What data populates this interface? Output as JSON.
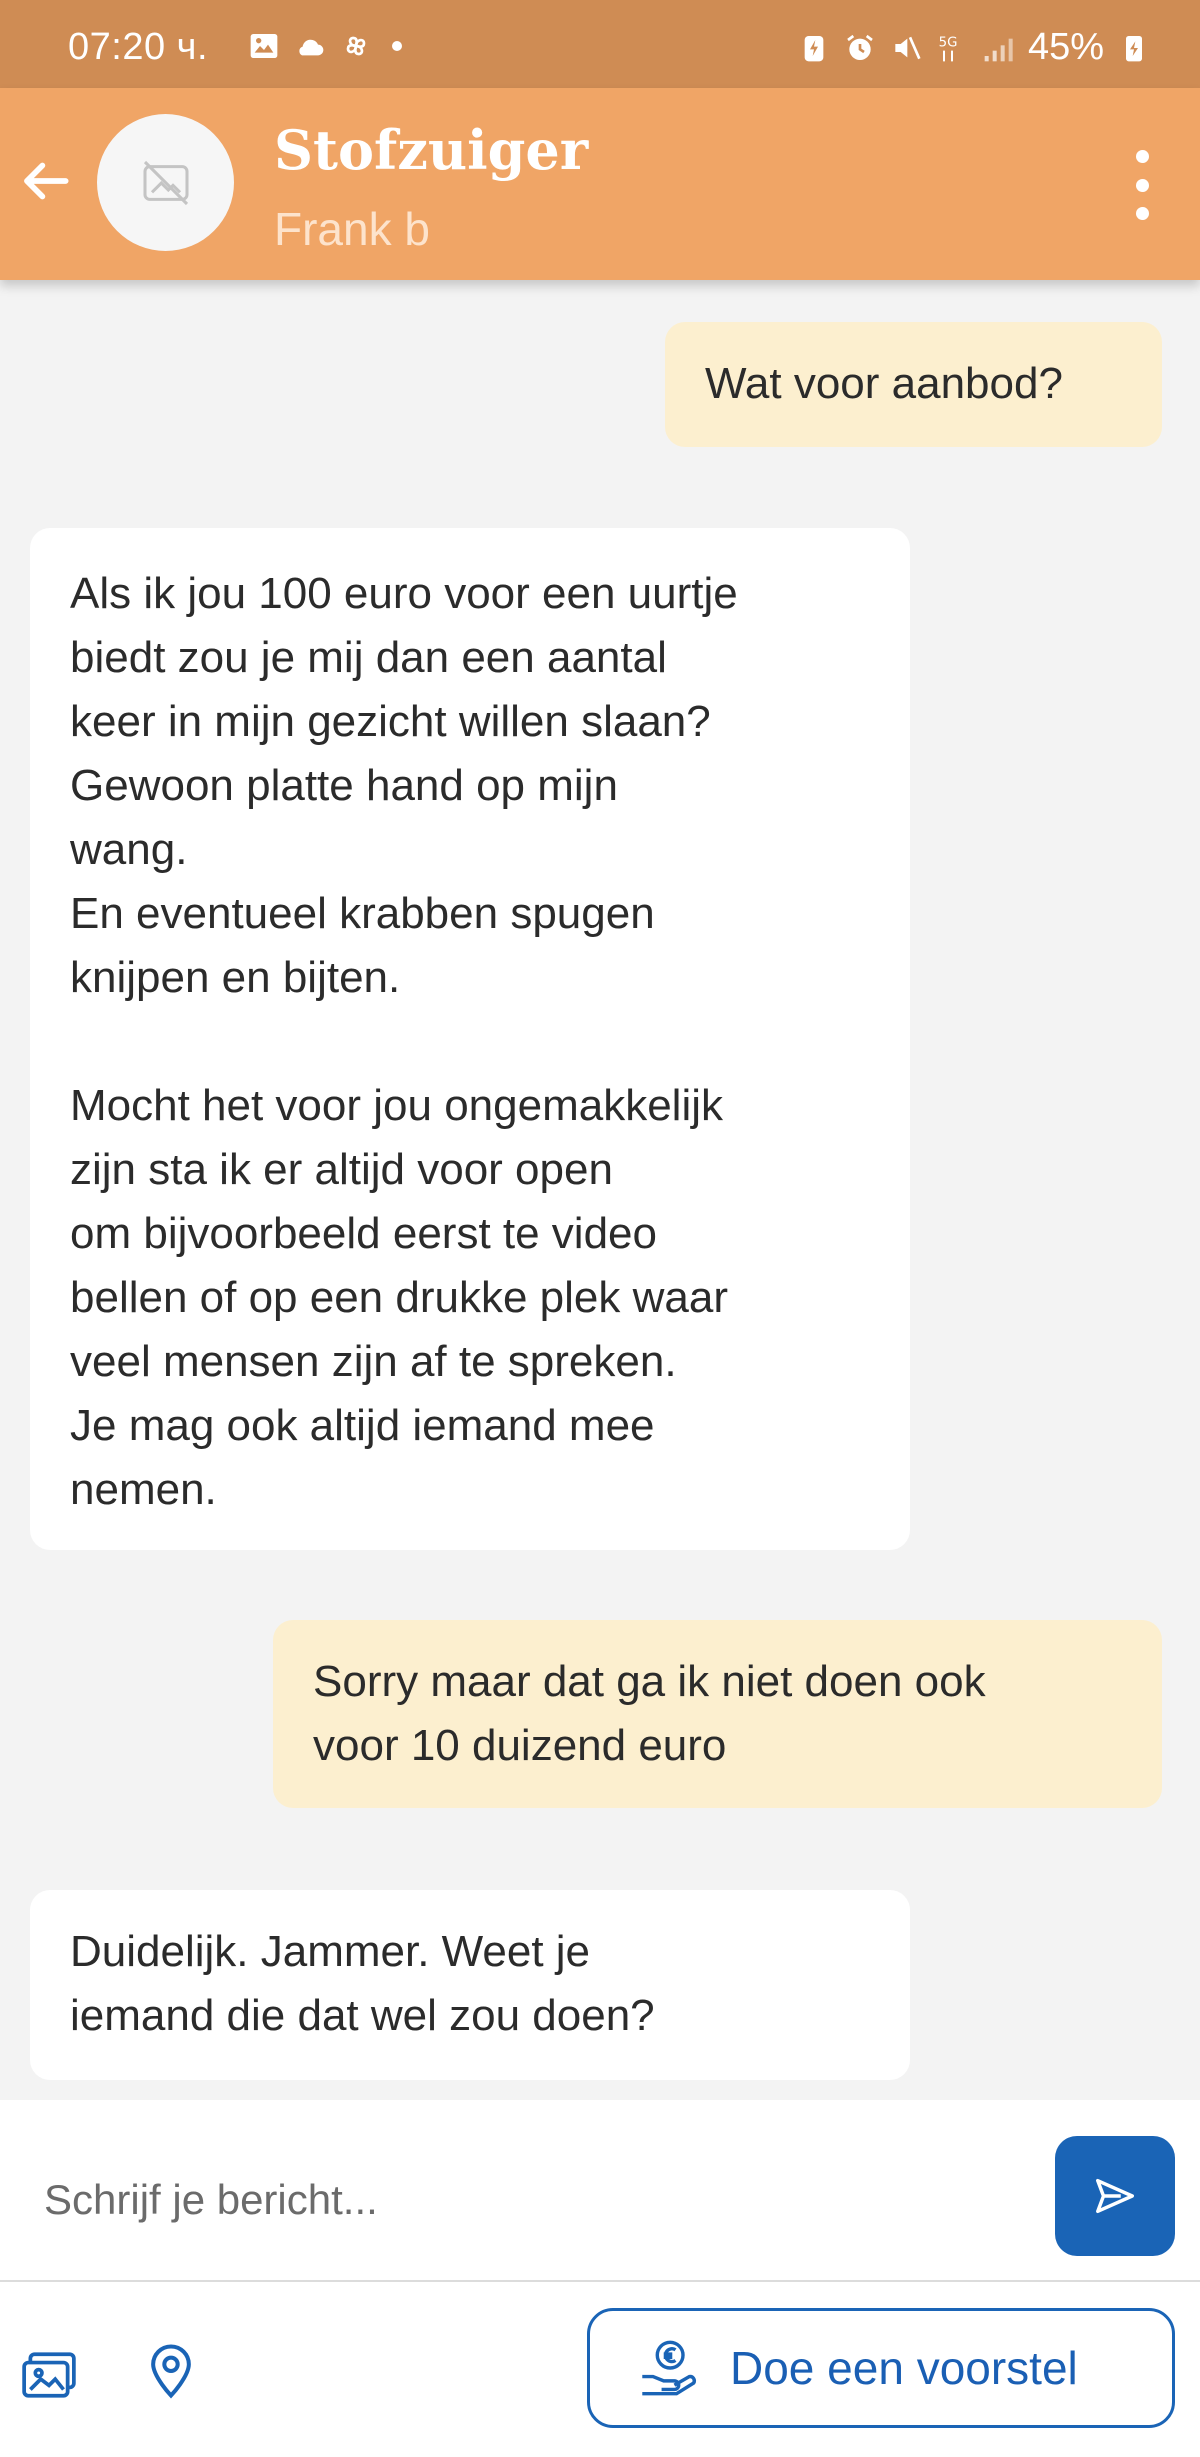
{
  "status_bar": {
    "time": "07:20 ч.",
    "battery": "45%"
  },
  "header": {
    "title": "Stofzuiger",
    "subtitle": "Frank b"
  },
  "messages": [
    {
      "direction": "outgoing",
      "text": "Wat voor aanbod?"
    },
    {
      "direction": "incoming",
      "text": "Als ik jou 100 euro voor een uurtje\nbiedt zou je mij dan een aantal\nkeer in mijn gezicht willen slaan?\nGewoon platte hand op mijn\nwang.\nEn eventueel krabben spugen\nknijpen en bijten.\n\nMocht het voor jou ongemakkelijk\nzijn sta ik er altijd voor open\nom bijvoorbeeld eerst te video\nbellen of op een drukke plek waar\nveel mensen zijn af te spreken.\nJe mag ook altijd iemand mee\nnemen."
    },
    {
      "direction": "outgoing",
      "text": "Sorry maar dat ga ik niet doen ook\nvoor 10 duizend euro"
    },
    {
      "direction": "incoming",
      "text": "Duidelijk. Jammer. Weet je\niemand die dat wel zou doen?"
    }
  ],
  "composer": {
    "placeholder": "Schrijf je bericht...",
    "value": ""
  },
  "bottom_bar": {
    "offer_label": "Doe een voorstel"
  },
  "icons": {
    "back": "arrow-left-icon",
    "avatar": "no-photo-icon",
    "menu": "more-vertical-icon",
    "send": "send-icon",
    "photo": "image-icon",
    "location": "map-pin-icon",
    "offer": "euro-hand-icon"
  },
  "colors": {
    "status_bar": "#cf8c54",
    "header": "#f0a566",
    "outgoing_bubble": "#fcefcf",
    "incoming_bubble": "#ffffff",
    "accent": "#1a64b6"
  }
}
